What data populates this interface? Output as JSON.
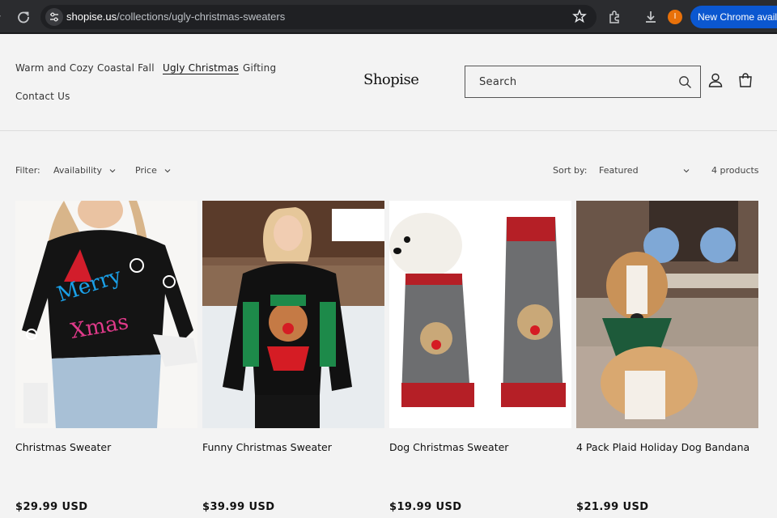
{
  "browser": {
    "url_host": "shopise.us",
    "url_path": "/collections/ugly-christmas-sweaters",
    "profile_initial": "I",
    "update_label": "New Chrome availa"
  },
  "header": {
    "nav": [
      "Warm and Cozy",
      "Coastal Fall",
      "Ugly Christmas",
      "Gifting",
      "Contact Us"
    ],
    "active_nav": "Ugly Christmas",
    "logo": "Shopise",
    "search_placeholder": "Search"
  },
  "filters": {
    "label": "Filter:",
    "availability": "Availability",
    "price": "Price",
    "sort_label": "Sort by:",
    "sort_value": "Featured",
    "count": "4 products"
  },
  "products": [
    {
      "name": "Christmas Sweater",
      "price": "$29.99 USD"
    },
    {
      "name": "Funny Christmas Sweater",
      "price": "$39.99 USD"
    },
    {
      "name": "Dog Christmas Sweater",
      "price": "$19.99 USD"
    },
    {
      "name": "4 Pack Plaid Holiday Dog Bandana",
      "price": "$21.99 USD"
    }
  ],
  "colors": {
    "chrome_bg": "#2b2c2f",
    "page_bg": "#f3f3f3",
    "update_button": "#0b57d0",
    "profile": "#e8710a"
  }
}
